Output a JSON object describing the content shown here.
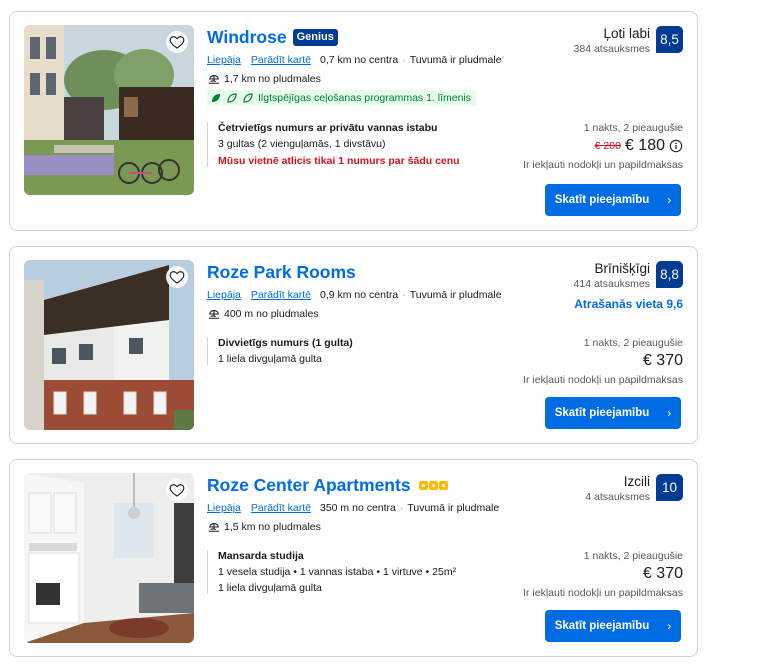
{
  "listings": [
    {
      "name": "Windrose",
      "badge": "Genius",
      "city_link": "Liepāja",
      "map_link": "Parādīt kartē",
      "distance_center": "0,7 km no centra",
      "near_beach": "Tuvumā ir pludmale",
      "beach_distance": "1,7 km no pludmales",
      "eco_label": "Ilgtspējīgas ceļošanas programmas 1. līmenis",
      "review_word": "Ļoti labi",
      "review_count": "384 atsauksmes",
      "score": "8,5",
      "room_title": "Četrvietīgs numurs ar privātu vannas istabu",
      "room_line1": "3 gultas (2 vienguļamās, 1 divstāvu)",
      "room_warning": "Mūsu vietnē atlicis tikai 1 numurs par šādu cenu",
      "nights": "1 nakts, 2 pieaugušie",
      "old_price": "€ 200",
      "price": "€ 180",
      "taxes": "Ir iekļauti nodokļi un papildmaksas",
      "button": "Skatīt pieejamību",
      "favourite": false
    },
    {
      "name": "Roze Park Rooms",
      "city_link": "Liepāja",
      "map_link": "Parādīt kartē",
      "distance_center": "0,9 km no centra",
      "near_beach": "Tuvumā ir pludmale",
      "beach_distance": "400 m no pludmales",
      "review_word": "Brīnišķīgi",
      "review_count": "414 atsauksmes",
      "score": "8,8",
      "location_score": "Atrašanās vieta 9,6",
      "room_title": "Divvietīgs numurs (1 gulta)",
      "room_line1": "1 liela divguļamā gulta",
      "nights": "1 nakts, 2 pieaugušie",
      "price": "€ 370",
      "taxes": "Ir iekļauti nodokļi un papildmaksas",
      "button": "Skatīt pieejamību",
      "favourite": false
    },
    {
      "name": "Roze Center Apartments",
      "stars": 3,
      "city_link": "Liepāja",
      "map_link": "Parādīt kartē",
      "distance_center": "350 m no centra",
      "near_beach": "Tuvumā ir pludmale",
      "beach_distance": "1,5 km no pludmales",
      "review_word": "Izcili",
      "review_count": "4 atsauksmes",
      "score": "10",
      "room_title": "Mansarda studija",
      "room_line1": "1 vesela studija • 1 vannas istaba • 1 virtuve • 25m²",
      "room_line2": "1 liela divguļamā gulta",
      "nights": "1 nakts, 2 pieaugušie",
      "price": "€ 370",
      "taxes": "Ir iekļauti nodokļi un papildmaksas",
      "button": "Skatīt pieejamību",
      "favourite": false
    }
  ],
  "colors": {
    "link_blue": "#006ce4",
    "score_navy": "#003b95",
    "warning_red": "#d4111e",
    "eco_green": "#008234",
    "star_yellow": "#febb02"
  }
}
